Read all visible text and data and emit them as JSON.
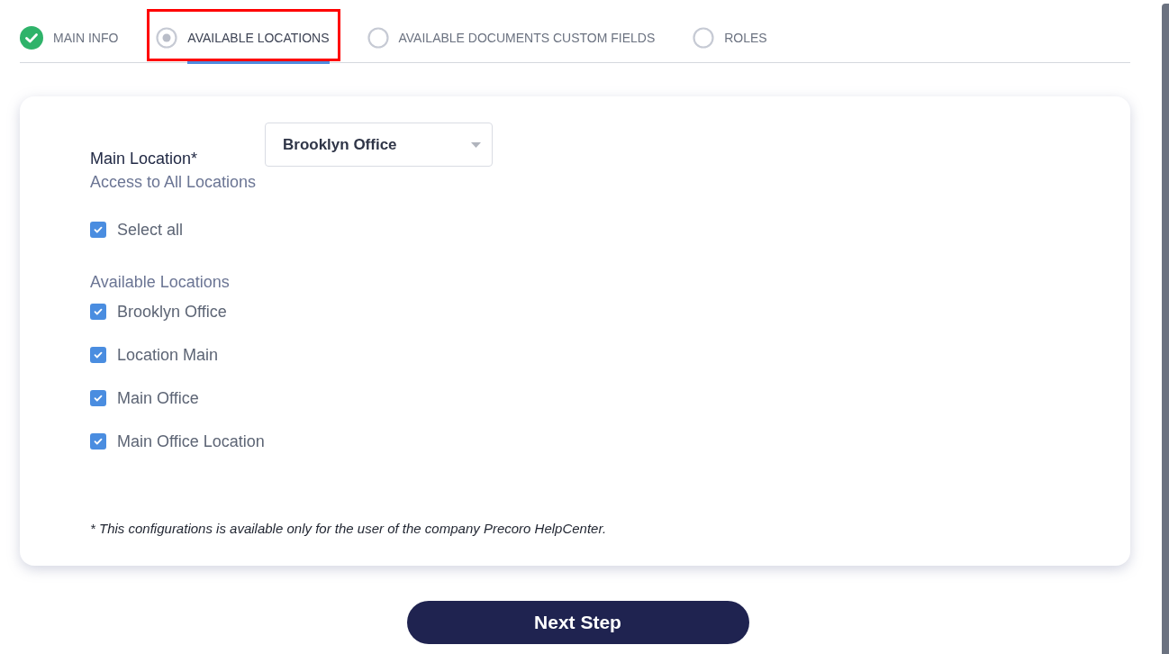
{
  "steps": [
    {
      "label": "MAIN INFO",
      "kind": "done",
      "selected": false,
      "highlighted": false
    },
    {
      "label": "AVAILABLE LOCATIONS",
      "kind": "current",
      "selected": true,
      "highlighted": true
    },
    {
      "label": "AVAILABLE DOCUMENTS CUSTOM FIELDS",
      "kind": "pending",
      "selected": false,
      "highlighted": false
    },
    {
      "label": "ROLES",
      "kind": "pending",
      "selected": false,
      "highlighted": false
    }
  ],
  "main_location": {
    "label": "Main Location*",
    "value": "Brooklyn Office"
  },
  "access_heading": "Access to All Locations",
  "select_all": {
    "label": "Select all",
    "checked": true
  },
  "locations_heading": "Available Locations",
  "locations": [
    {
      "label": "Brooklyn Office",
      "checked": true
    },
    {
      "label": "Location Main",
      "checked": true
    },
    {
      "label": "Main Office",
      "checked": true
    },
    {
      "label": "Main Office Location",
      "checked": true
    }
  ],
  "footnote": "* This configurations is available only for the user of the company Precoro HelpCenter.",
  "next_button": "Next Step"
}
